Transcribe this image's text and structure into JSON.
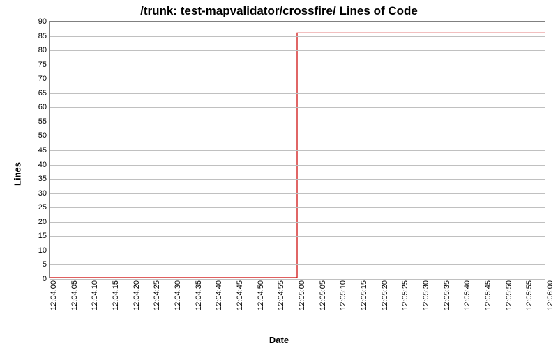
{
  "chart_data": {
    "type": "line",
    "title": "/trunk: test-mapvalidator/crossfire/ Lines of Code",
    "xlabel": "Date",
    "ylabel": "Lines",
    "ylim": [
      0,
      90
    ],
    "y_ticks": [
      0,
      5,
      10,
      15,
      20,
      25,
      30,
      35,
      40,
      45,
      50,
      55,
      60,
      65,
      70,
      75,
      80,
      85,
      90
    ],
    "x_ticks": [
      "12:04:00",
      "12:04:05",
      "12:04:10",
      "12:04:15",
      "12:04:20",
      "12:04:25",
      "12:04:30",
      "12:04:35",
      "12:04:40",
      "12:04:45",
      "12:04:50",
      "12:04:55",
      "12:05:00",
      "12:05:05",
      "12:05:10",
      "12:05:15",
      "12:05:20",
      "12:05:25",
      "12:05:30",
      "12:05:35",
      "12:05:40",
      "12:05:45",
      "12:05:50",
      "12:05:55",
      "12:06:00"
    ],
    "series": [
      {
        "name": "Lines of Code",
        "color": "#cc0000",
        "x": [
          "12:04:00",
          "12:04:05",
          "12:04:10",
          "12:04:15",
          "12:04:20",
          "12:04:25",
          "12:04:30",
          "12:04:35",
          "12:04:40",
          "12:04:45",
          "12:04:50",
          "12:04:55",
          "12:05:00",
          "12:05:05",
          "12:05:10",
          "12:05:15",
          "12:05:20",
          "12:05:25",
          "12:05:30",
          "12:05:35",
          "12:05:40",
          "12:05:45",
          "12:05:50",
          "12:05:55",
          "12:06:00"
        ],
        "values": [
          0,
          0,
          0,
          0,
          0,
          0,
          0,
          0,
          0,
          0,
          0,
          0,
          86,
          86,
          86,
          86,
          86,
          86,
          86,
          86,
          86,
          86,
          86,
          86,
          86
        ]
      }
    ]
  }
}
